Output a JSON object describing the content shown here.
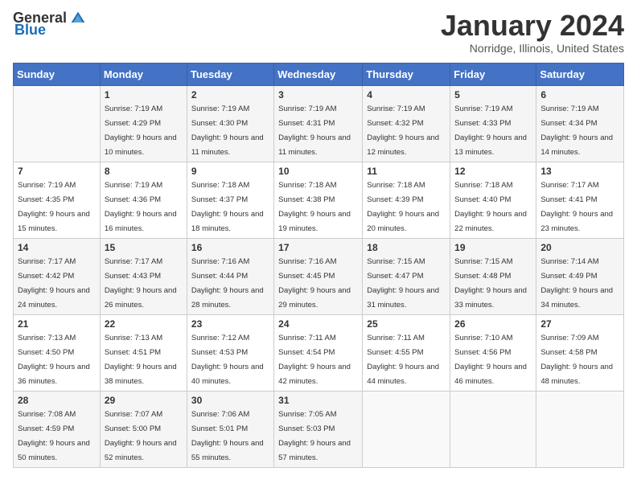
{
  "logo": {
    "general": "General",
    "blue": "Blue"
  },
  "header": {
    "title": "January 2024",
    "location": "Norridge, Illinois, United States"
  },
  "weekdays": [
    "Sunday",
    "Monday",
    "Tuesday",
    "Wednesday",
    "Thursday",
    "Friday",
    "Saturday"
  ],
  "weeks": [
    [
      {
        "day": "",
        "sunrise": "",
        "sunset": "",
        "daylight": ""
      },
      {
        "day": "1",
        "sunrise": "Sunrise: 7:19 AM",
        "sunset": "Sunset: 4:29 PM",
        "daylight": "Daylight: 9 hours and 10 minutes."
      },
      {
        "day": "2",
        "sunrise": "Sunrise: 7:19 AM",
        "sunset": "Sunset: 4:30 PM",
        "daylight": "Daylight: 9 hours and 11 minutes."
      },
      {
        "day": "3",
        "sunrise": "Sunrise: 7:19 AM",
        "sunset": "Sunset: 4:31 PM",
        "daylight": "Daylight: 9 hours and 11 minutes."
      },
      {
        "day": "4",
        "sunrise": "Sunrise: 7:19 AM",
        "sunset": "Sunset: 4:32 PM",
        "daylight": "Daylight: 9 hours and 12 minutes."
      },
      {
        "day": "5",
        "sunrise": "Sunrise: 7:19 AM",
        "sunset": "Sunset: 4:33 PM",
        "daylight": "Daylight: 9 hours and 13 minutes."
      },
      {
        "day": "6",
        "sunrise": "Sunrise: 7:19 AM",
        "sunset": "Sunset: 4:34 PM",
        "daylight": "Daylight: 9 hours and 14 minutes."
      }
    ],
    [
      {
        "day": "7",
        "sunrise": "Sunrise: 7:19 AM",
        "sunset": "Sunset: 4:35 PM",
        "daylight": "Daylight: 9 hours and 15 minutes."
      },
      {
        "day": "8",
        "sunrise": "Sunrise: 7:19 AM",
        "sunset": "Sunset: 4:36 PM",
        "daylight": "Daylight: 9 hours and 16 minutes."
      },
      {
        "day": "9",
        "sunrise": "Sunrise: 7:18 AM",
        "sunset": "Sunset: 4:37 PM",
        "daylight": "Daylight: 9 hours and 18 minutes."
      },
      {
        "day": "10",
        "sunrise": "Sunrise: 7:18 AM",
        "sunset": "Sunset: 4:38 PM",
        "daylight": "Daylight: 9 hours and 19 minutes."
      },
      {
        "day": "11",
        "sunrise": "Sunrise: 7:18 AM",
        "sunset": "Sunset: 4:39 PM",
        "daylight": "Daylight: 9 hours and 20 minutes."
      },
      {
        "day": "12",
        "sunrise": "Sunrise: 7:18 AM",
        "sunset": "Sunset: 4:40 PM",
        "daylight": "Daylight: 9 hours and 22 minutes."
      },
      {
        "day": "13",
        "sunrise": "Sunrise: 7:17 AM",
        "sunset": "Sunset: 4:41 PM",
        "daylight": "Daylight: 9 hours and 23 minutes."
      }
    ],
    [
      {
        "day": "14",
        "sunrise": "Sunrise: 7:17 AM",
        "sunset": "Sunset: 4:42 PM",
        "daylight": "Daylight: 9 hours and 24 minutes."
      },
      {
        "day": "15",
        "sunrise": "Sunrise: 7:17 AM",
        "sunset": "Sunset: 4:43 PM",
        "daylight": "Daylight: 9 hours and 26 minutes."
      },
      {
        "day": "16",
        "sunrise": "Sunrise: 7:16 AM",
        "sunset": "Sunset: 4:44 PM",
        "daylight": "Daylight: 9 hours and 28 minutes."
      },
      {
        "day": "17",
        "sunrise": "Sunrise: 7:16 AM",
        "sunset": "Sunset: 4:45 PM",
        "daylight": "Daylight: 9 hours and 29 minutes."
      },
      {
        "day": "18",
        "sunrise": "Sunrise: 7:15 AM",
        "sunset": "Sunset: 4:47 PM",
        "daylight": "Daylight: 9 hours and 31 minutes."
      },
      {
        "day": "19",
        "sunrise": "Sunrise: 7:15 AM",
        "sunset": "Sunset: 4:48 PM",
        "daylight": "Daylight: 9 hours and 33 minutes."
      },
      {
        "day": "20",
        "sunrise": "Sunrise: 7:14 AM",
        "sunset": "Sunset: 4:49 PM",
        "daylight": "Daylight: 9 hours and 34 minutes."
      }
    ],
    [
      {
        "day": "21",
        "sunrise": "Sunrise: 7:13 AM",
        "sunset": "Sunset: 4:50 PM",
        "daylight": "Daylight: 9 hours and 36 minutes."
      },
      {
        "day": "22",
        "sunrise": "Sunrise: 7:13 AM",
        "sunset": "Sunset: 4:51 PM",
        "daylight": "Daylight: 9 hours and 38 minutes."
      },
      {
        "day": "23",
        "sunrise": "Sunrise: 7:12 AM",
        "sunset": "Sunset: 4:53 PM",
        "daylight": "Daylight: 9 hours and 40 minutes."
      },
      {
        "day": "24",
        "sunrise": "Sunrise: 7:11 AM",
        "sunset": "Sunset: 4:54 PM",
        "daylight": "Daylight: 9 hours and 42 minutes."
      },
      {
        "day": "25",
        "sunrise": "Sunrise: 7:11 AM",
        "sunset": "Sunset: 4:55 PM",
        "daylight": "Daylight: 9 hours and 44 minutes."
      },
      {
        "day": "26",
        "sunrise": "Sunrise: 7:10 AM",
        "sunset": "Sunset: 4:56 PM",
        "daylight": "Daylight: 9 hours and 46 minutes."
      },
      {
        "day": "27",
        "sunrise": "Sunrise: 7:09 AM",
        "sunset": "Sunset: 4:58 PM",
        "daylight": "Daylight: 9 hours and 48 minutes."
      }
    ],
    [
      {
        "day": "28",
        "sunrise": "Sunrise: 7:08 AM",
        "sunset": "Sunset: 4:59 PM",
        "daylight": "Daylight: 9 hours and 50 minutes."
      },
      {
        "day": "29",
        "sunrise": "Sunrise: 7:07 AM",
        "sunset": "Sunset: 5:00 PM",
        "daylight": "Daylight: 9 hours and 52 minutes."
      },
      {
        "day": "30",
        "sunrise": "Sunrise: 7:06 AM",
        "sunset": "Sunset: 5:01 PM",
        "daylight": "Daylight: 9 hours and 55 minutes."
      },
      {
        "day": "31",
        "sunrise": "Sunrise: 7:05 AM",
        "sunset": "Sunset: 5:03 PM",
        "daylight": "Daylight: 9 hours and 57 minutes."
      },
      {
        "day": "",
        "sunrise": "",
        "sunset": "",
        "daylight": ""
      },
      {
        "day": "",
        "sunrise": "",
        "sunset": "",
        "daylight": ""
      },
      {
        "day": "",
        "sunrise": "",
        "sunset": "",
        "daylight": ""
      }
    ]
  ]
}
